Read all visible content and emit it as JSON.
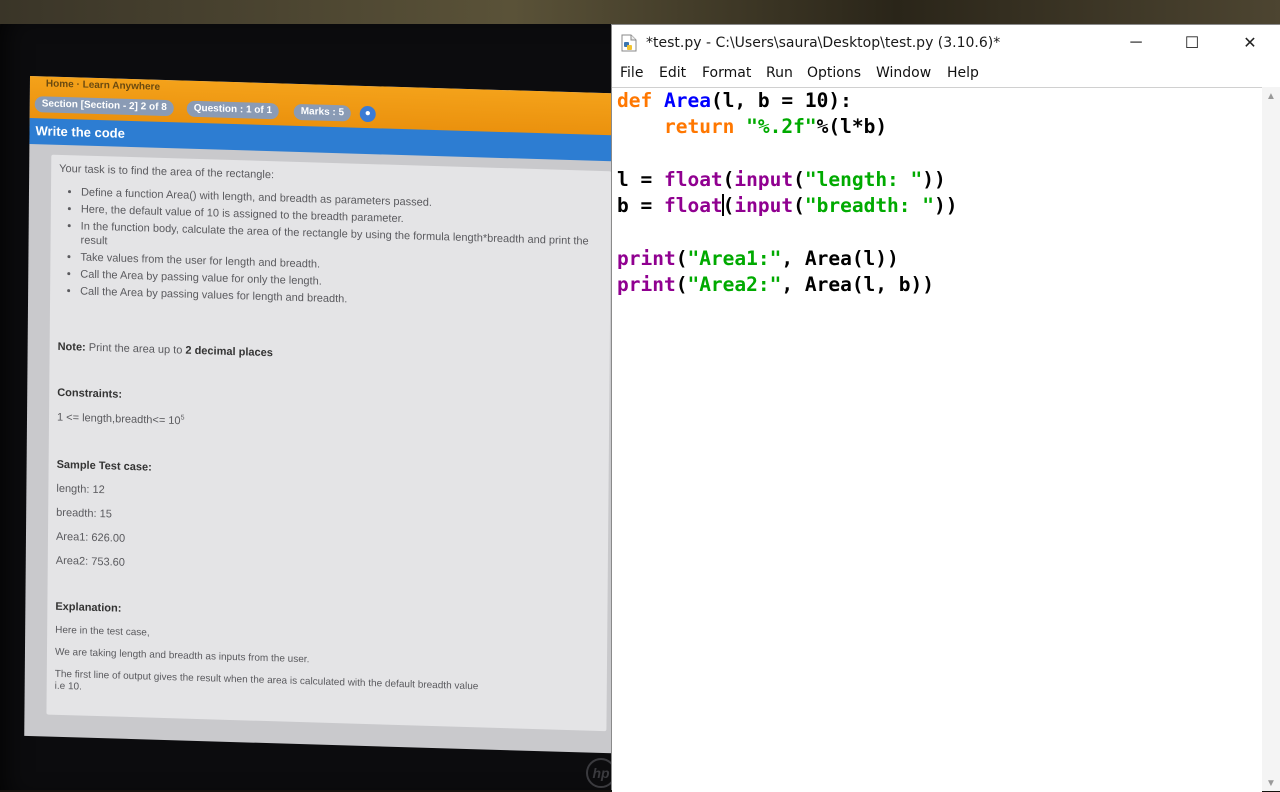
{
  "quiz": {
    "crumb": "Home  ·  Learn Anywhere",
    "section_pill": "Section [Section - 2] 2 of 8",
    "question_pill": "Question : 1 of 1",
    "marks_pill": "Marks : 5",
    "header": "Write the code",
    "intro": "Your task is to find the area of the rectangle:",
    "items": [
      "Define a function Area() with length, and breadth as parameters passed.",
      "Here, the default value of 10 is assigned to the breadth parameter.",
      "In the function body, calculate the area of the rectangle by using the formula length*breadth and print the result",
      "Take values from the user for length and breadth.",
      "Call the Area by passing value for only the length.",
      "Call the Area by passing values for length and breadth."
    ],
    "note_label": "Note:",
    "note_text": "Print the area up to",
    "note_bold": "2 decimal places",
    "constraints_label": "Constraints:",
    "constraints_text": "1 <= length,breadth<= 10",
    "constraints_sup": "5",
    "sample_label": "Sample Test case:",
    "sample_lines": [
      "length: 12",
      "breadth: 15",
      "Area1: 626.00",
      "Area2: 753.60"
    ],
    "explanation_label": "Explanation:",
    "explanation_lines": [
      "Here in the test case,",
      "We are taking length and breadth as inputs from the user.",
      "The first line of output gives the result when the area is calculated with the default breadth value",
      "i.e 10."
    ],
    "logo": "hp"
  },
  "idle": {
    "title": "*test.py - C:\\Users\\saura\\Desktop\\test.py (3.10.6)*",
    "menu": [
      "File",
      "Edit",
      "Format",
      "Run",
      "Options",
      "Window",
      "Help"
    ],
    "buttons": {
      "minimize": "─",
      "maximize": "☐",
      "close": "✕"
    }
  },
  "colors": {
    "keyword": "#ff7700",
    "builtin": "#900090",
    "definition": "#0000ff",
    "string": "#00aa00",
    "quiz_orange": "#f4a21a",
    "quiz_blue": "#2d7dd2"
  }
}
